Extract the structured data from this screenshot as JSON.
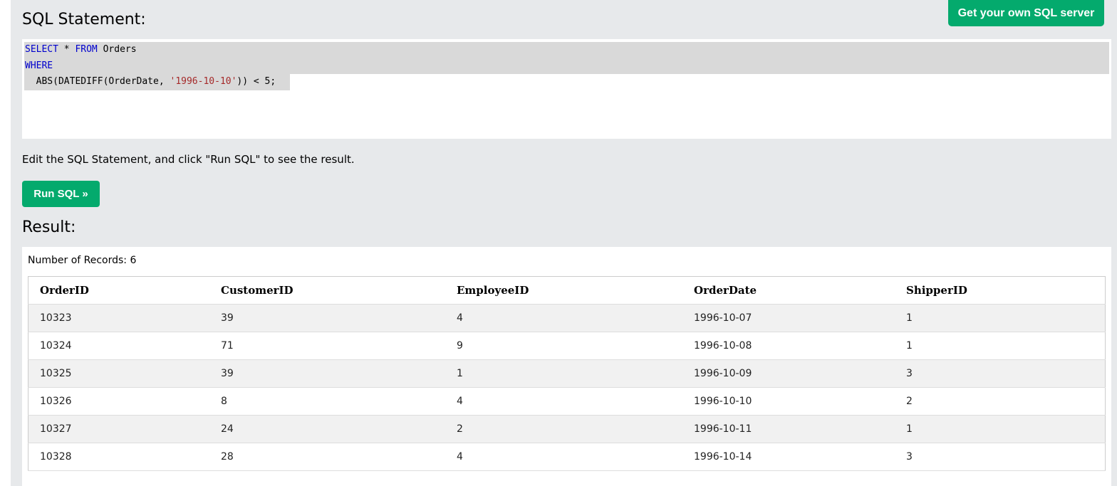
{
  "header": {
    "sql_title": "SQL Statement:",
    "server_button": "Get your own SQL server"
  },
  "editor": {
    "line1": {
      "kw1": "SELECT",
      "mid": " * ",
      "kw2": "FROM",
      "rest": " Orders"
    },
    "line2": {
      "kw": "WHERE"
    },
    "line3": {
      "pre": "  ABS(DATEDIFF(OrderDate, ",
      "str": "'1996-10-10'",
      "post": ")) < 5;"
    }
  },
  "hint": "Edit the SQL Statement, and click \"Run SQL\" to see the result.",
  "run_button": "Run SQL »",
  "result": {
    "title": "Result:",
    "count_text": "Number of Records: 6",
    "columns": [
      "OrderID",
      "CustomerID",
      "EmployeeID",
      "OrderDate",
      "ShipperID"
    ],
    "rows": [
      [
        "10323",
        "39",
        "4",
        "1996-10-07",
        "1"
      ],
      [
        "10324",
        "71",
        "9",
        "1996-10-08",
        "1"
      ],
      [
        "10325",
        "39",
        "1",
        "1996-10-09",
        "3"
      ],
      [
        "10326",
        "8",
        "4",
        "1996-10-10",
        "2"
      ],
      [
        "10327",
        "24",
        "2",
        "1996-10-11",
        "1"
      ],
      [
        "10328",
        "28",
        "4",
        "1996-10-14",
        "3"
      ]
    ]
  },
  "colors": {
    "accent_green": "#04aa6d",
    "page_background": "#e7e9eb",
    "sql_keyword": "#0000cd",
    "sql_string": "#a52a2a"
  }
}
